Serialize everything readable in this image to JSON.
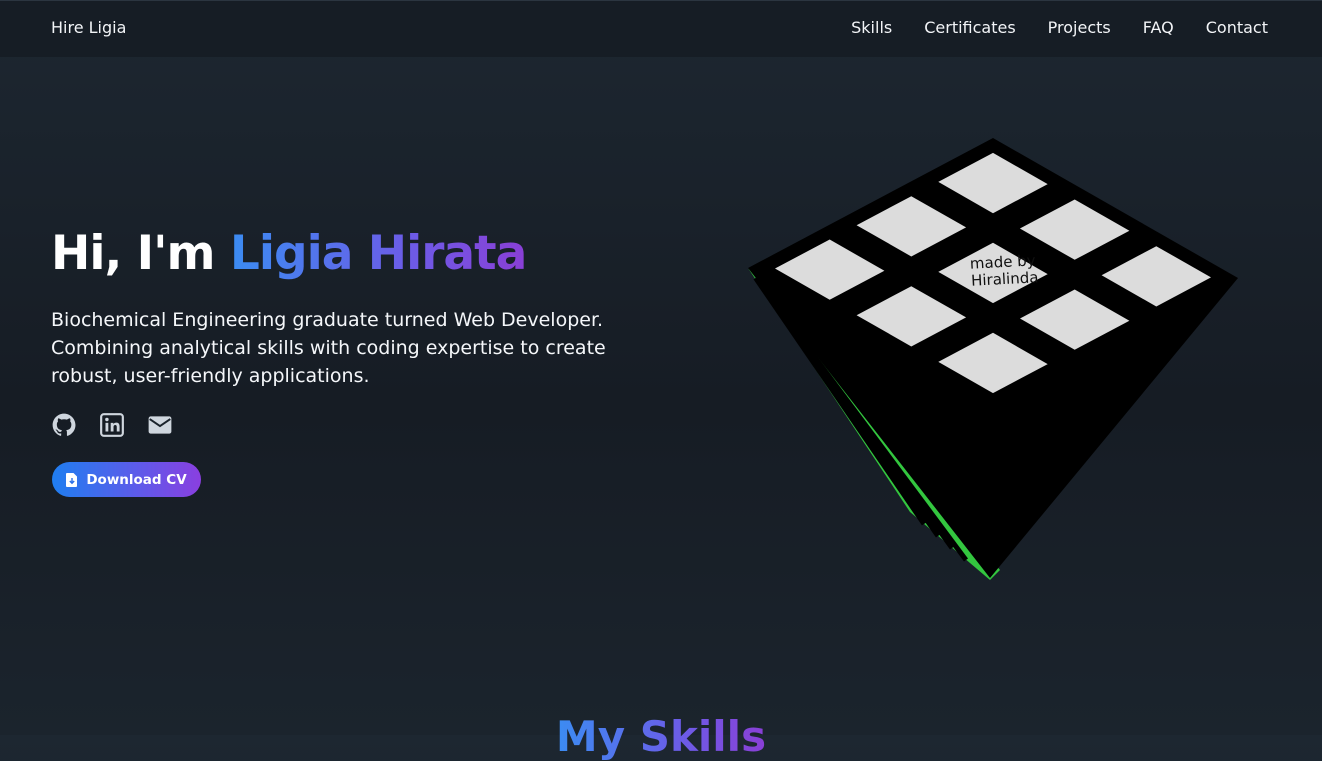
{
  "nav": {
    "brand": "Hire Ligia",
    "links": [
      "Skills",
      "Certificates",
      "Projects",
      "FAQ",
      "Contact"
    ]
  },
  "hero": {
    "greeting": "Hi, I'm",
    "name": "Ligia Hirata",
    "description": "Biochemical Engineering graduate turned Web Developer. Combining analytical skills with coding expertise to create robust, user-friendly applications.",
    "socials": [
      "github-icon",
      "linkedin-icon",
      "email-icon"
    ],
    "cv_button": "Download CV"
  },
  "cube": {
    "sticker_text": [
      "made by",
      "Hiralinda"
    ],
    "colors": {
      "top": "#dcdcdc",
      "side": "#37c842",
      "frame": "#000000"
    }
  },
  "skills": {
    "title": "My Skills"
  },
  "colors": {
    "background": "#1a222b",
    "accent_start": "#3b8cf2",
    "accent_end": "#8a3fd6"
  }
}
